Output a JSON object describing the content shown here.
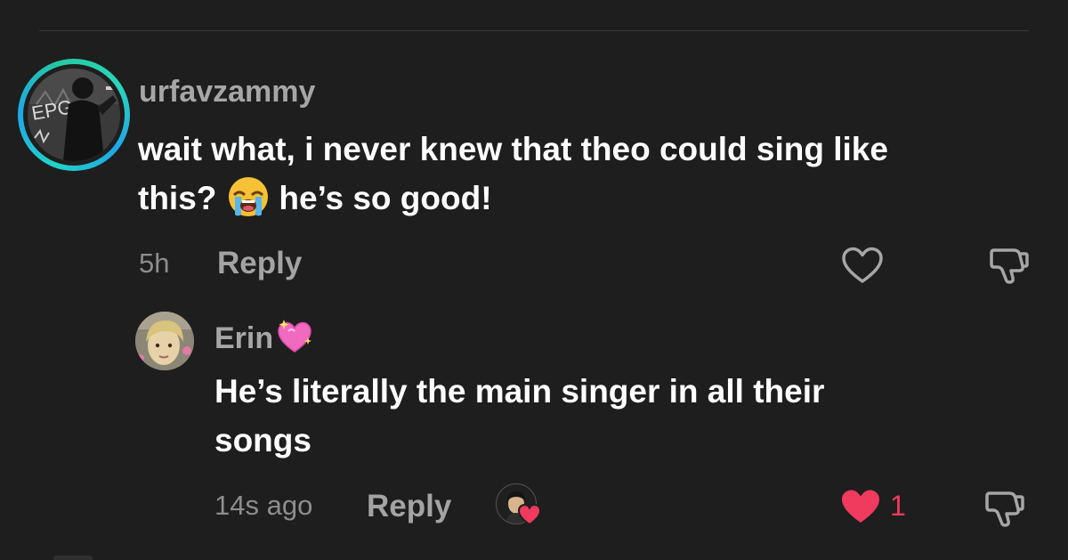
{
  "comment": {
    "username": "urfavzammy",
    "text_line1": "wait what, i never knew that theo could sing like",
    "text_line2_before": "this?",
    "emoji": "loudly-crying-face-emoji",
    "text_line2_after": "he’s so good!",
    "time": "5h",
    "reply_label": "Reply",
    "avatar_ring_colors": [
      "#22d3c5",
      "#1ea7e8",
      "#25c9a3"
    ]
  },
  "reply": {
    "username": "Erin",
    "username_emoji": "sparkling-heart-emoji",
    "text_line1": "He’s literally the main singer in all their",
    "text_line2": "songs",
    "time": "14s ago",
    "reply_label": "Reply",
    "like_count": "1",
    "liked": true,
    "creator_liked": true
  },
  "colors": {
    "background": "#1e1e1e",
    "muted_text": "#a6a6a6",
    "like_red": "#f03a5e"
  }
}
